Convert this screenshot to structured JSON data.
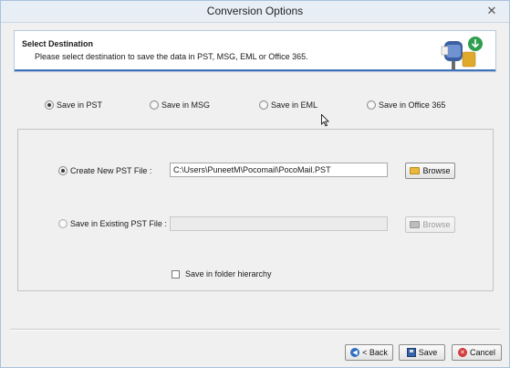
{
  "window": {
    "title": "Conversion Options",
    "close_glyph": "✕"
  },
  "header": {
    "title": "Select Destination",
    "description": "Please select destination to save the data in PST, MSG, EML or Office 365.",
    "icon": "mailbox-download-icon"
  },
  "destinations": [
    {
      "label": "Save in PST",
      "selected": true
    },
    {
      "label": "Save in MSG",
      "selected": false
    },
    {
      "label": "Save in EML",
      "selected": false
    },
    {
      "label": "Save in Office 365",
      "selected": false
    }
  ],
  "pst_options": {
    "create_new": {
      "label": "Create New PST File :",
      "selected": true,
      "path": "C:\\Users\\PuneetM\\Pocomail\\PocoMail.PST",
      "browse_label": "Browse"
    },
    "existing": {
      "label": "Save in Existing PST File :",
      "selected": false,
      "path": "",
      "browse_label": "Browse",
      "enabled": false
    },
    "folder_hierarchy": {
      "label": "Save in folder hierarchy",
      "checked": false
    }
  },
  "footer": {
    "back_label": "< Back",
    "save_label": "Save",
    "cancel_label": "Cancel"
  },
  "colors": {
    "accent": "#3f72b8",
    "title_bar": "#e8eef5"
  }
}
